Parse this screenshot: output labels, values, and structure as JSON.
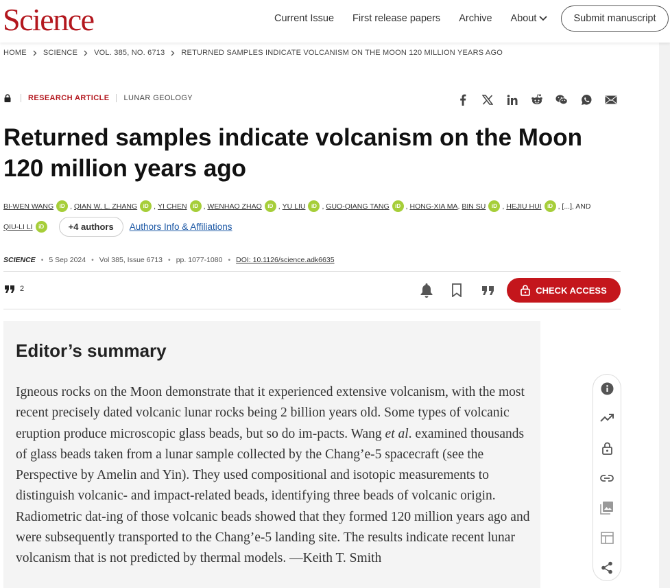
{
  "header": {
    "logo": "Science",
    "nav": [
      "Current Issue",
      "First release papers",
      "Archive",
      "About"
    ],
    "submit_label": "Submit manuscript"
  },
  "breadcrumb": [
    "HOME",
    "SCIENCE",
    "VOL. 385, NO. 6713",
    "RETURNED SAMPLES INDICATE VOLCANISM ON THE MOON 120 MILLION YEARS AGO"
  ],
  "article": {
    "type": "RESEARCH ARTICLE",
    "subject": "LUNAR GEOLOGY",
    "title": "Returned samples indicate volcanism on the Moon 120 million years ago",
    "authors": [
      "BI-WEN WANG",
      "QIAN W. L. ZHANG",
      "YI CHEN",
      "WENHAO ZHAO",
      "YU LIU",
      "GUO-QIANG TANG",
      "HONG-XIA MA",
      "BIN SU",
      "HEJIU HUI",
      "QIU-LI LI"
    ],
    "orcid_label": "iD",
    "ellipsis": ", [...], AND",
    "more_authors": "+4 authors",
    "affiliations_link": "Authors Info & Affiliations",
    "journal": "SCIENCE",
    "date": "5 Sep 2024",
    "volume": "Vol 385, Issue 6713",
    "pages": "pp. 1077-1080",
    "doi": "DOI: 10.1126/science.adk6635",
    "citations": "2",
    "check_access": "CHECK ACCESS"
  },
  "share_icons": [
    "facebook-icon",
    "x-icon",
    "linkedin-icon",
    "reddit-icon",
    "wechat-icon",
    "whatsapp-icon",
    "email-icon"
  ],
  "summary": {
    "heading": "Editor’s summary",
    "p1": "Igneous rocks on the Moon demonstrate that it experienced extensive volcanism, with the most recent precisely dated volcanic lunar rocks being 2 billion years old. Some types of volcanic eruption produce microscopic glass beads, but so do im-pacts. Wang ",
    "p_italic": "et al",
    "p2": ". examined thousands of glass beads taken from a lunar sample collected by the Chang’e-5 spacecraft (see the Perspective by Amelin and Yin). They used compositional and isotopic measurements to distinguish volcanic- and impact-related beads, identifying three beads of volcanic origin. Radiometric dat-ing of those volcanic beads showed that they formed 120 million years ago and were subsequently transported to the Chang’e-5 landing site. The results indicate recent lunar volcanism that is not predicted by thermal models. —Keith T. Smith"
  },
  "rail_icons": [
    "info-icon",
    "trending-icon",
    "lock-open-icon",
    "link-icon",
    "images-icon",
    "table-icon",
    "share-icon"
  ],
  "colors": {
    "brand": "#b3171e",
    "access": "#c4161c",
    "orcid": "#a6ce39",
    "link": "#1f5aa6"
  }
}
